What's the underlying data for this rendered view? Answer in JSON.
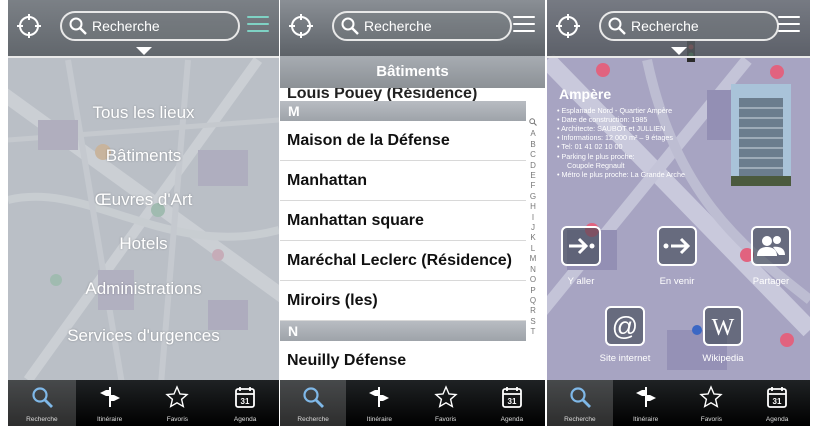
{
  "left_screen": {
    "search_placeholder": "Recherche",
    "categories": [
      "Tous les lieux",
      "Bâtiments",
      "Œuvres d'Art",
      "Hotels",
      "Administrations",
      "Services d'urgences"
    ]
  },
  "middle_screen": {
    "search_placeholder": "Recherche",
    "header": "Bâtiments",
    "partial_row": "Louis Pouey (Résidence)",
    "sections": [
      {
        "letter": "M",
        "items": [
          "Maison de la Défense",
          "Manhattan",
          "Manhattan square",
          "Maréchal Leclerc (Résidence)",
          "Miroirs (les)"
        ]
      },
      {
        "letter": "N",
        "items": [
          "Neuilly Défense"
        ]
      }
    ],
    "index_letters": [
      "A",
      "B",
      "C",
      "D",
      "E",
      "F",
      "G",
      "H",
      "I",
      "J",
      "K",
      "L",
      "M",
      "N",
      "O",
      "P",
      "Q",
      "R",
      "S",
      "T"
    ]
  },
  "right_screen": {
    "search_placeholder": "Recherche",
    "title": "Ampère",
    "details": [
      "• Esplanade Nord - Quartier Ampère",
      "• Date de construction: 1985",
      "• Architecte: SAUBOT et JULLIEN",
      "• Informations: 12 000 m² – 9 étages",
      "• Tel: 01 41 02 10 00",
      "• Parking le plus proche:",
      "  Coupole Regnault",
      "• Métro le plus proche: La Grande Arche"
    ],
    "actions": [
      "Y aller",
      "En venir",
      "Partager",
      "Site internet",
      "Wikipedia"
    ]
  },
  "tabbar": [
    "Recherche",
    "Itinéraire",
    "Favoris",
    "Agenda"
  ],
  "calendar_day": "31",
  "icons": {
    "locate": "crosshair-icon",
    "search": "magnifier-icon",
    "menu": "hamburger-icon",
    "itinerary": "signpost-icon",
    "favorites": "star-icon",
    "agenda": "calendar-icon",
    "go_to": "arrow-to-icon",
    "come_from": "arrow-from-icon",
    "share": "people-icon",
    "website": "at-icon",
    "wikipedia": "wikipedia-icon"
  },
  "colors": {
    "accent": "#7fd2c4",
    "tab_bg": "#111111"
  }
}
